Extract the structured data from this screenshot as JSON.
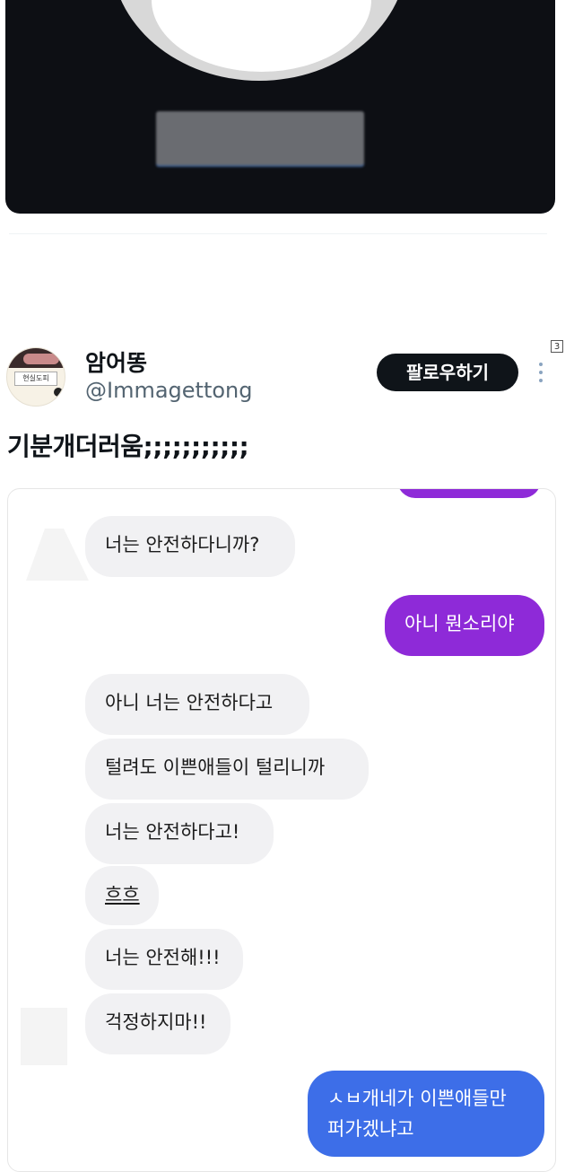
{
  "top_card": {
    "description": ""
  },
  "page_marker": "3",
  "tweet": {
    "display_name": "암어똥",
    "handle": "@Immagettong",
    "follow_label": "팔로우하기",
    "text": "기분개더러움;;;;;;;;;;;",
    "avatar_label": "현실도피"
  },
  "chat": {
    "messages": [
      {
        "side": "in",
        "text": "너는 안전하다니까?"
      },
      {
        "side": "out",
        "text": "아니 뭔소리야"
      },
      {
        "side": "in",
        "text": "아니 너는 안전하다고"
      },
      {
        "side": "in",
        "text": "털려도 이쁜애들이 털리니까"
      },
      {
        "side": "in",
        "text": "너는 안전하다고!"
      },
      {
        "side": "in",
        "text": "흐흐"
      },
      {
        "side": "in",
        "text": "너는 안전해!!!"
      },
      {
        "side": "in",
        "text": "걱정하지마!!"
      },
      {
        "side": "out",
        "text": "ㅅㅂ개네가 이쁜애들만 퍼가겠냐고"
      }
    ]
  },
  "colors": {
    "follow_bg": "#0f1419",
    "outgoing_purple": "#8e2ad8",
    "outgoing_blue": "#3d6ee8",
    "incoming_bg": "#f1f1f3"
  }
}
